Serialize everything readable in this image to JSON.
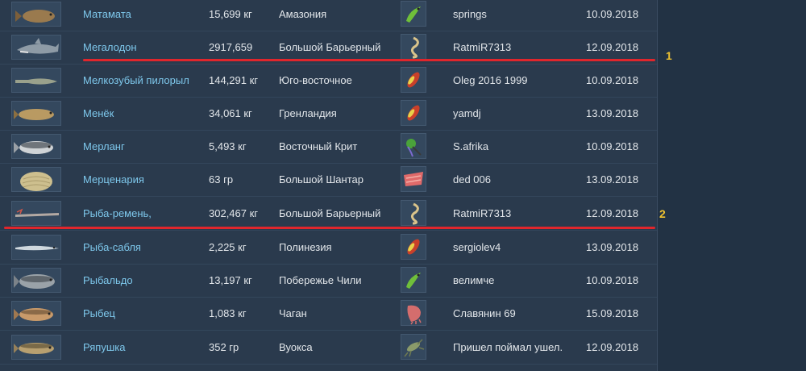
{
  "rows": [
    {
      "name": "Матамата",
      "weight": "15,699 кг",
      "place": "Амазония",
      "angler": "springs",
      "date": "10.09.2018",
      "fish_icon": "matamata-fish-icon",
      "bait_icon": "green-soft-lure-icon"
    },
    {
      "name": "Мегалодон",
      "weight": "2917,659",
      "place": "Большой Барьерный",
      "angler": "RatmiR7313",
      "date": "12.09.2018",
      "fish_icon": "megalodon-shark-icon",
      "bait_icon": "spiral-eel-bait-icon"
    },
    {
      "name": "Мелкозубый пилорыл",
      "weight": "144,291 кг",
      "place": "Юго-восточное",
      "angler": "Oleg 2016 1999",
      "date": "10.09.2018",
      "fish_icon": "sawfish-icon",
      "bait_icon": "red-wobbler-icon"
    },
    {
      "name": "Менёк",
      "weight": "34,061 кг",
      "place": "Гренландия",
      "angler": "yamdj",
      "date": "13.09.2018",
      "fish_icon": "burbot-fish-icon",
      "bait_icon": "red-wobbler-icon"
    },
    {
      "name": "Мерланг",
      "weight": "5,493 кг",
      "place": "Восточный Крит",
      "angler": "S.afrika",
      "date": "10.09.2018",
      "fish_icon": "whiting-fish-icon",
      "bait_icon": "green-jig-icon"
    },
    {
      "name": "Мерценария",
      "weight": "63 гр",
      "place": "Большой Шантар",
      "angler": "ded 006",
      "date": "13.09.2018",
      "fish_icon": "clam-shell-icon",
      "bait_icon": "fish-fillet-bait-icon"
    },
    {
      "name": "Рыба-ремень,",
      "weight": "302,467 кг",
      "place": "Большой Барьерный",
      "angler": "RatmiR7313",
      "date": "12.09.2018",
      "fish_icon": "oarfish-icon",
      "bait_icon": "spiral-eel-bait-icon"
    },
    {
      "name": "Рыба-сабля",
      "weight": "2,225 кг",
      "place": "Полинезия",
      "angler": "sergiolev4",
      "date": "13.09.2018",
      "fish_icon": "cutlassfish-icon",
      "bait_icon": "red-wobbler-icon"
    },
    {
      "name": "Рыбальдо",
      "weight": "13,197 кг",
      "place": "Побережье Чили",
      "angler": "велимче",
      "date": "10.09.2018",
      "fish_icon": "rubaldo-fish-icon",
      "bait_icon": "green-soft-lure-icon"
    },
    {
      "name": "Рыбец",
      "weight": "1,083 кг",
      "place": "Чаган",
      "angler": "Славянин 69",
      "date": "15.09.2018",
      "fish_icon": "vimba-fish-icon",
      "bait_icon": "squid-bait-icon"
    },
    {
      "name": "Ряпушка",
      "weight": "352 гр",
      "place": "Вуокса",
      "angler": "Пришел поймал ушел.",
      "date": "12.09.2018",
      "fish_icon": "vendace-fish-icon",
      "bait_icon": "grasshopper-bait-icon"
    }
  ],
  "markers": [
    "1",
    "2"
  ],
  "colors": {
    "highlight_line": "#e0262c",
    "marker": "#f0c330",
    "name_link": "#7ec8ec",
    "panel": "#2a3a4d"
  }
}
